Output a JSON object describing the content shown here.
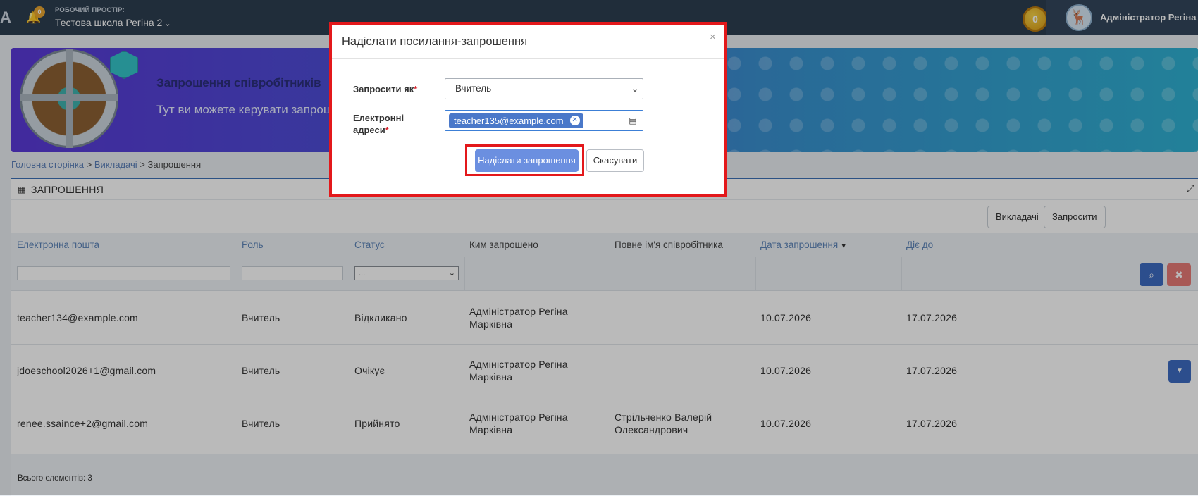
{
  "topbar": {
    "brand_letter": "A",
    "notification_count": "0",
    "workspace_caption": "РОБОЧИЙ ПРОСТІР:",
    "workspace_name": "Тестова школа Регіна 2",
    "coins": "0",
    "user_name": "Адміністратор Регіна"
  },
  "banner": {
    "title": "Запрошення співробітників",
    "subtitle": "Тут ви можете керувати запрош"
  },
  "breadcrumb": {
    "home": "Головна сторінка",
    "sep1": " > ",
    "teachers": "Викладачі",
    "sep2": " > ",
    "current": "Запрошення"
  },
  "panel": {
    "title": "ЗАПРОШЕННЯ",
    "toolbar": {
      "teachers_btn": "Викладачі",
      "invite_btn": "Запросити"
    },
    "columns": {
      "email": "Електронна пошта",
      "role": "Роль",
      "status": "Статус",
      "invited_by": "Ким запрошено",
      "full_name": "Повне ім'я співробітника",
      "invite_date": "Дата запрошення",
      "valid_until": "Діє до"
    },
    "filters": {
      "status_selected": "..."
    },
    "rows": [
      {
        "email": "teacher134@example.com",
        "role": "Вчитель",
        "status": "Відкликано",
        "invited_by_1": "Адміністратор Регіна",
        "invited_by_2": "Марківна",
        "full_name_1": "",
        "full_name_2": "",
        "invite_date": "10.07.2026",
        "valid_until": "17.07.2026"
      },
      {
        "email": "jdoeschool2026+1@gmail.com",
        "role": "Вчитель",
        "status": "Очікує",
        "invited_by_1": "Адміністратор Регіна",
        "invited_by_2": "Марківна",
        "full_name_1": "",
        "full_name_2": "",
        "invite_date": "10.07.2026",
        "valid_until": "17.07.2026"
      },
      {
        "email": "renee.ssaince+2@gmail.com",
        "role": "Вчитель",
        "status": "Прийнято",
        "invited_by_1": "Адміністратор Регіна",
        "invited_by_2": "Марківна",
        "full_name_1": "Стрільченко Валерій",
        "full_name_2": "Олександрович",
        "invite_date": "10.07.2026",
        "valid_until": "17.07.2026"
      }
    ],
    "footer": "Всього елементів: 3"
  },
  "modal": {
    "title": "Надіслати посилання-запрошення",
    "close": "×",
    "invite_as_label": "Запросити як",
    "role_value": "Вчитель",
    "emails_label_1": "Електронні",
    "emails_label_2": "адреси",
    "required_mark": "*",
    "email_tag": "teacher135@example.com",
    "send_label": "Надіслати запрошення",
    "cancel_label": "Скасувати"
  },
  "colors": {
    "topbar": "#2d3e50",
    "accent_blue": "#3d6cc2",
    "highlight_red": "#e3181b",
    "link": "#5d84b8"
  }
}
